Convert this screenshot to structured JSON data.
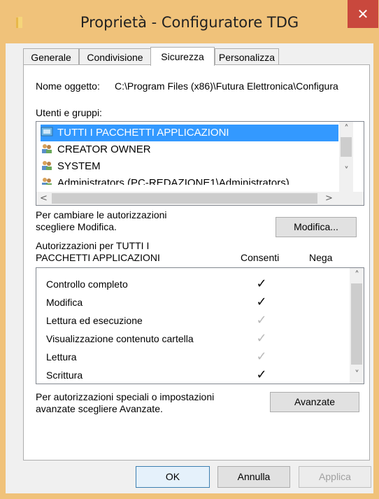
{
  "window": {
    "title": "Proprietà - Configuratore TDG",
    "close_glyph": "✕",
    "folder_icon": "folder-icon"
  },
  "tabs": [
    {
      "label": "Generale",
      "active": false
    },
    {
      "label": "Condivisione",
      "active": false
    },
    {
      "label": "Sicurezza",
      "active": true
    },
    {
      "label": "Personalizza",
      "active": false
    }
  ],
  "security": {
    "object_label": "Nome oggetto:",
    "object_value": "C:\\Program Files (x86)\\Futura Elettronica\\Configura",
    "groups_label": "Utenti e gruppi:",
    "groups": [
      {
        "name": "TUTTI I PACCHETTI APPLICAZIONI",
        "icon": "app-packages-icon",
        "selected": true
      },
      {
        "name": "CREATOR OWNER",
        "icon": "users-icon",
        "selected": false
      },
      {
        "name": "SYSTEM",
        "icon": "users-icon",
        "selected": false
      },
      {
        "name": "Administrators (PC-REDAZIONE1\\Administrators)",
        "icon": "users-icon",
        "selected": false
      }
    ],
    "change_text_1": "Per cambiare le autorizzazioni",
    "change_text_2": "scegliere Modifica.",
    "modify_button": "Modifica...",
    "perm_header_1": "Autorizzazioni per TUTTI I",
    "perm_header_2": "PACCHETTI APPLICAZIONI",
    "col_allow": "Consenti",
    "col_deny": "Nega",
    "permissions": [
      {
        "name": "Controllo completo",
        "allow": "✓",
        "allow_style": "dark"
      },
      {
        "name": "Modifica",
        "allow": "✓",
        "allow_style": "dark"
      },
      {
        "name": "Lettura ed esecuzione",
        "allow": "✓",
        "allow_style": "gray"
      },
      {
        "name": "Visualizzazione contenuto cartella",
        "allow": "✓",
        "allow_style": "gray"
      },
      {
        "name": "Lettura",
        "allow": "✓",
        "allow_style": "gray"
      },
      {
        "name": "Scrittura",
        "allow": "✓",
        "allow_style": "dark"
      }
    ],
    "advanced_text_1": "Per autorizzazioni speciali o impostazioni",
    "advanced_text_2": "avanzate scegliere Avanzate.",
    "advanced_button": "Avanzate"
  },
  "footer": {
    "ok": "OK",
    "cancel": "Annulla",
    "apply": "Applica"
  },
  "scroll_glyphs": {
    "up": "˄",
    "down": "˅",
    "left": "<",
    "right": ">"
  }
}
